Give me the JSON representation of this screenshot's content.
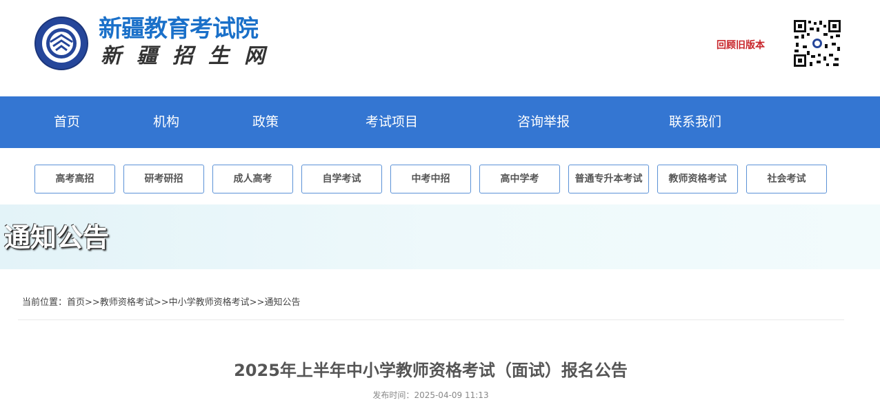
{
  "header": {
    "site_name": "新疆教育考试院",
    "site_subtitle": "新疆招生网",
    "old_version_link": "回顾旧版本",
    "qr_code_icon": "qr-code"
  },
  "nav": {
    "items": [
      "首页",
      "机构",
      "政策",
      "考试项目",
      "咨询举报",
      "联系我们"
    ]
  },
  "categories": [
    "高考高招",
    "研考研招",
    "成人高考",
    "自学考试",
    "中考中招",
    "高中学考",
    "普通专升本考试",
    "教师资格考试",
    "社会考试"
  ],
  "banner": {
    "title": "通知公告"
  },
  "breadcrumb": {
    "prefix": "当前位置：",
    "items": [
      "首页",
      "教师资格考试",
      "中小学教师资格考试",
      "通知公告"
    ],
    "separator": ">>"
  },
  "article": {
    "title": "2025年上半年中小学教师资格考试（面试）报名公告",
    "publish_label": "发布时间：",
    "publish_time": "2025-04-09 11:13"
  },
  "colors": {
    "nav_bg": "#3476d2",
    "brand_blue": "#1a70c9",
    "link_red": "#c8252a"
  }
}
